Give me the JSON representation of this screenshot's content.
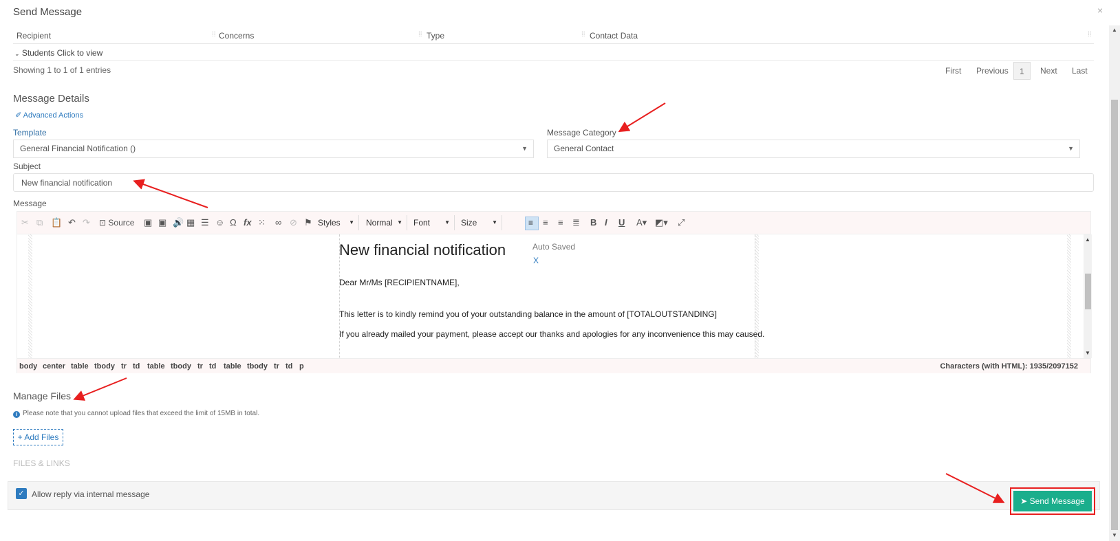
{
  "modal": {
    "title": "Send Message",
    "close_glyph": "×"
  },
  "recipients_table": {
    "columns": [
      "Recipient",
      "Concerns",
      "Type",
      "Contact Data"
    ],
    "group_row": "Students Click to view",
    "showing": "Showing 1 to 1 of 1 entries",
    "pagination": {
      "first": "First",
      "previous": "Previous",
      "current": "1",
      "next": "Next",
      "last": "Last"
    }
  },
  "message_details": {
    "heading": "Message Details",
    "advanced_actions": "Advanced Actions",
    "template_label": "Template",
    "template_value": "General Financial Notification ()",
    "category_label": "Message Category",
    "category_value": "General Contact",
    "subject_label": "Subject",
    "subject_value": "New financial notification",
    "message_label": "Message"
  },
  "editor": {
    "toolbar": {
      "source_label": "Source",
      "styles": "Styles",
      "format": "Normal",
      "font": "Font",
      "size": "Size",
      "bold": "B",
      "italic": "I",
      "underline": "U"
    },
    "document": {
      "heading": "New financial notification",
      "auto_saved": "Auto Saved",
      "auto_saved_close": "X",
      "greeting": "Dear Mr/Ms [RECIPIENTNAME],",
      "line1": "This letter is to kindly remind you of your outstanding balance in the amount of [TOTALOUTSTANDING]",
      "line2": "If you already mailed your payment, please accept our thanks and apologies for any inconvenience this may caused."
    },
    "element_path": [
      "body",
      "center",
      "table",
      "tbody",
      "tr",
      "td",
      "table",
      "tbody",
      "tr",
      "td",
      "table",
      "tbody",
      "tr",
      "td",
      "p"
    ],
    "char_count": "Characters (with HTML): 1935/2097152"
  },
  "files": {
    "heading": "Manage Files",
    "note": "Please note that you cannot upload files that exceed the limit of 15MB in total.",
    "add_button": "+ Add Files",
    "links_heading": "FILES & LINKS"
  },
  "footer": {
    "allow_reply_label": "Allow reply via internal message",
    "allow_reply_checked": true,
    "send_button": "Send Message"
  },
  "colors": {
    "accent": "#2e7bbf",
    "send": "#1aae8c",
    "annotation": "#e81f1f"
  }
}
